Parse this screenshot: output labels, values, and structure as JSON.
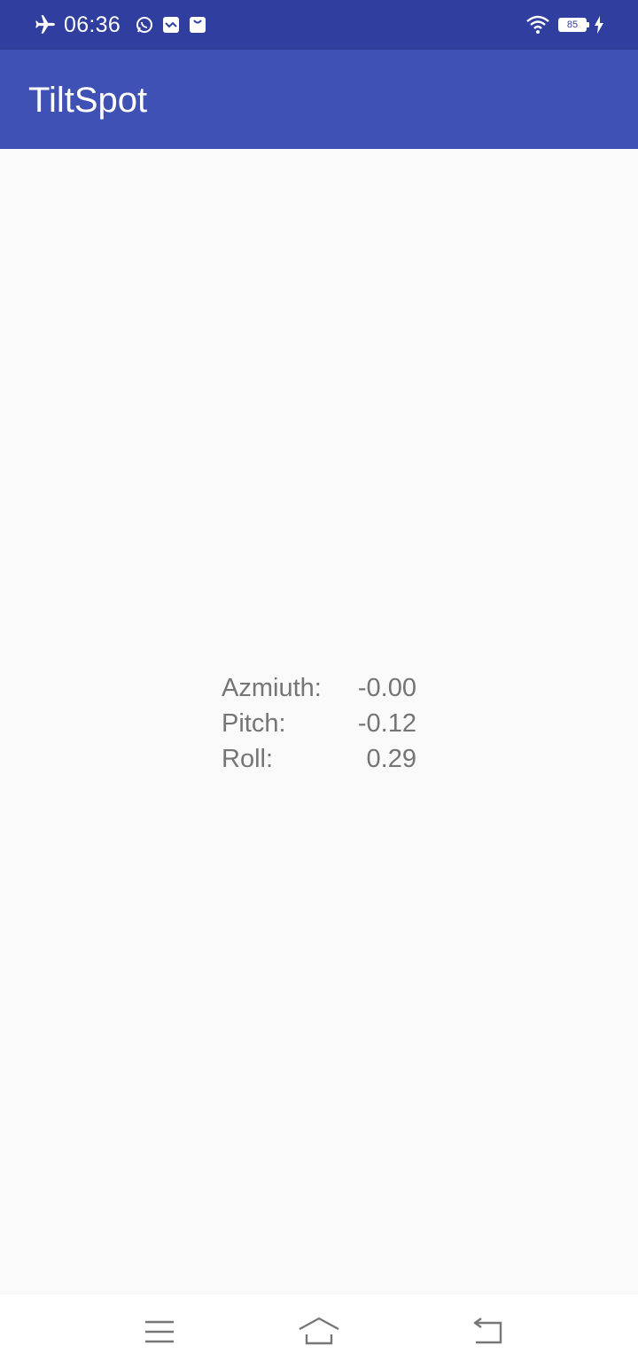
{
  "status_bar": {
    "time": "06:36",
    "battery_level": "85",
    "icons": [
      "airplane-icon",
      "whatsapp-icon",
      "message-icon",
      "shopping-bag-icon",
      "wifi-icon",
      "battery-icon",
      "charging-icon"
    ]
  },
  "app_bar": {
    "title": "TiltSpot"
  },
  "readings": [
    {
      "label": "Azmiuth:",
      "value": "-0.00"
    },
    {
      "label": "Pitch:",
      "value": "-0.12"
    },
    {
      "label": "Roll:",
      "value": "0.29"
    }
  ],
  "nav_bar": {
    "icons": [
      "menu-icon",
      "home-icon",
      "back-icon"
    ]
  },
  "colors": {
    "status_bar": "#303f9f",
    "app_bar": "#3f51b5",
    "background": "#fafafa",
    "reading_text": "#757575"
  }
}
